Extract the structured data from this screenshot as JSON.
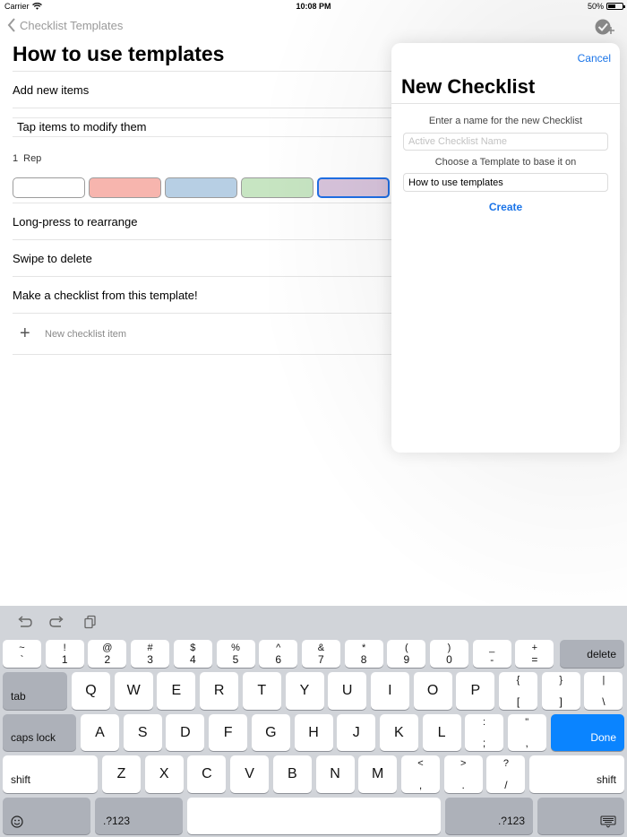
{
  "status": {
    "carrier": "Carrier",
    "time": "10:08 PM",
    "battery": "50%",
    "battery_level": 0.5
  },
  "nav": {
    "back_label": "Checklist Templates"
  },
  "page": {
    "title": "How to use templates"
  },
  "items": {
    "add_new": "Add new items",
    "tap_modify": "Tap items to modify them",
    "rep_count": "1",
    "rep_label": "Rep",
    "long_press": "Long-press to rearrange",
    "swipe": "Swipe to delete",
    "make_checklist": "Make a checklist from this template!",
    "new_item_placeholder": "New checklist item"
  },
  "colors": {
    "swatches": [
      "#ffffff",
      "#f7b5ae",
      "#b7cfe4",
      "#c7e5c2",
      "#d8c4dc"
    ],
    "selected_index": 4,
    "accent": "#1a74e8",
    "done": "#0a84ff"
  },
  "popover": {
    "cancel": "Cancel",
    "title": "New Checklist",
    "name_prompt": "Enter a name for the new Checklist",
    "name_placeholder": "Active Checklist Name",
    "template_prompt": "Choose a Template to base it on",
    "template_value": "How to use templates",
    "create": "Create"
  },
  "keyboard": {
    "toolbar": [
      "undo-icon",
      "redo-icon",
      "paste-icon"
    ],
    "row1": [
      {
        "top": "~",
        "bot": "`"
      },
      {
        "top": "!",
        "bot": "1"
      },
      {
        "top": "@",
        "bot": "2"
      },
      {
        "top": "#",
        "bot": "3"
      },
      {
        "top": "$",
        "bot": "4"
      },
      {
        "top": "%",
        "bot": "5"
      },
      {
        "top": "^",
        "bot": "6"
      },
      {
        "top": "&",
        "bot": "7"
      },
      {
        "top": "*",
        "bot": "8"
      },
      {
        "top": "(",
        "bot": "9"
      },
      {
        "top": ")",
        "bot": "0"
      },
      {
        "top": "_",
        "bot": "-"
      },
      {
        "top": "+",
        "bot": "="
      }
    ],
    "delete": "delete",
    "tab": "tab",
    "row2": [
      "Q",
      "W",
      "E",
      "R",
      "T",
      "Y",
      "U",
      "I",
      "O",
      "P"
    ],
    "row2_sym": [
      {
        "top": "{",
        "bot": "["
      },
      {
        "top": "}",
        "bot": "]"
      },
      {
        "top": "|",
        "bot": "\\"
      }
    ],
    "caps": "caps lock",
    "row3": [
      "A",
      "S",
      "D",
      "F",
      "G",
      "H",
      "J",
      "K",
      "L"
    ],
    "row3_sym": [
      {
        "top": ":",
        "bot": ";"
      },
      {
        "top": "\"",
        "bot": ","
      }
    ],
    "done": "Done",
    "shift": "shift",
    "row4": [
      "Z",
      "X",
      "C",
      "V",
      "B",
      "N",
      "M"
    ],
    "row4_sym": [
      {
        "top": "<",
        "bot": ","
      },
      {
        "top": ">",
        "bot": "."
      },
      {
        "top": "?",
        "bot": "/"
      }
    ],
    "numbers": ".?123",
    "emoji_icon": "emoji-icon",
    "dismiss_icon": "keyboard-dismiss-icon"
  }
}
